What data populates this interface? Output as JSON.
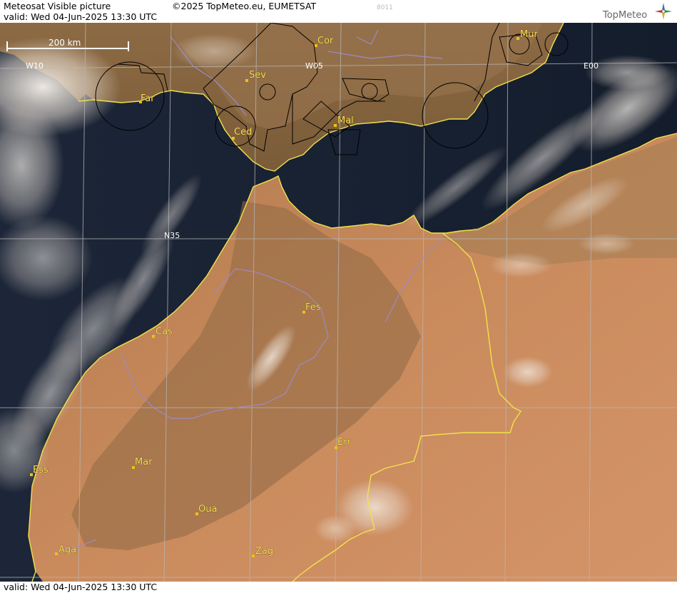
{
  "header": {
    "product_title": "Meteosat Visible picture",
    "copyright": "©2025 TopMeteo.eu, EUMETSAT",
    "image_code": "8011",
    "valid_time": "valid:  Wed  04-Jun-2025  13:30 UTC",
    "logo_text": "TopMeteo"
  },
  "footer": {
    "valid_time": "valid:  Wed  04-Jun-2025  13:30 UTC"
  },
  "map": {
    "scale_bar_label": "200 km",
    "grid_labels": {
      "w10": "W10",
      "w05": "W05",
      "e00": "E00",
      "n35": "N35"
    },
    "cities": {
      "far": "Far",
      "sev": "Sev",
      "cor": "Cor",
      "mur": "Mur",
      "ced": "Ced",
      "mal": "Mal",
      "fes": "Fes",
      "cas": "Cas",
      "err": "Err",
      "ess": "Ess",
      "mar": "Mar",
      "oua": "Oua",
      "aga": "Aga",
      "zag": "Zag"
    },
    "colors": {
      "sea": "#152033",
      "land_desert": "#c9855a",
      "land_spain": "#8a6a44",
      "coastline": "#f2e24a",
      "river_border": "#9c8bc4",
      "airspace": "#000000",
      "grid": "#b8b8b8",
      "city_marker": "#f0c010",
      "cloud": "#f2ece6"
    }
  }
}
